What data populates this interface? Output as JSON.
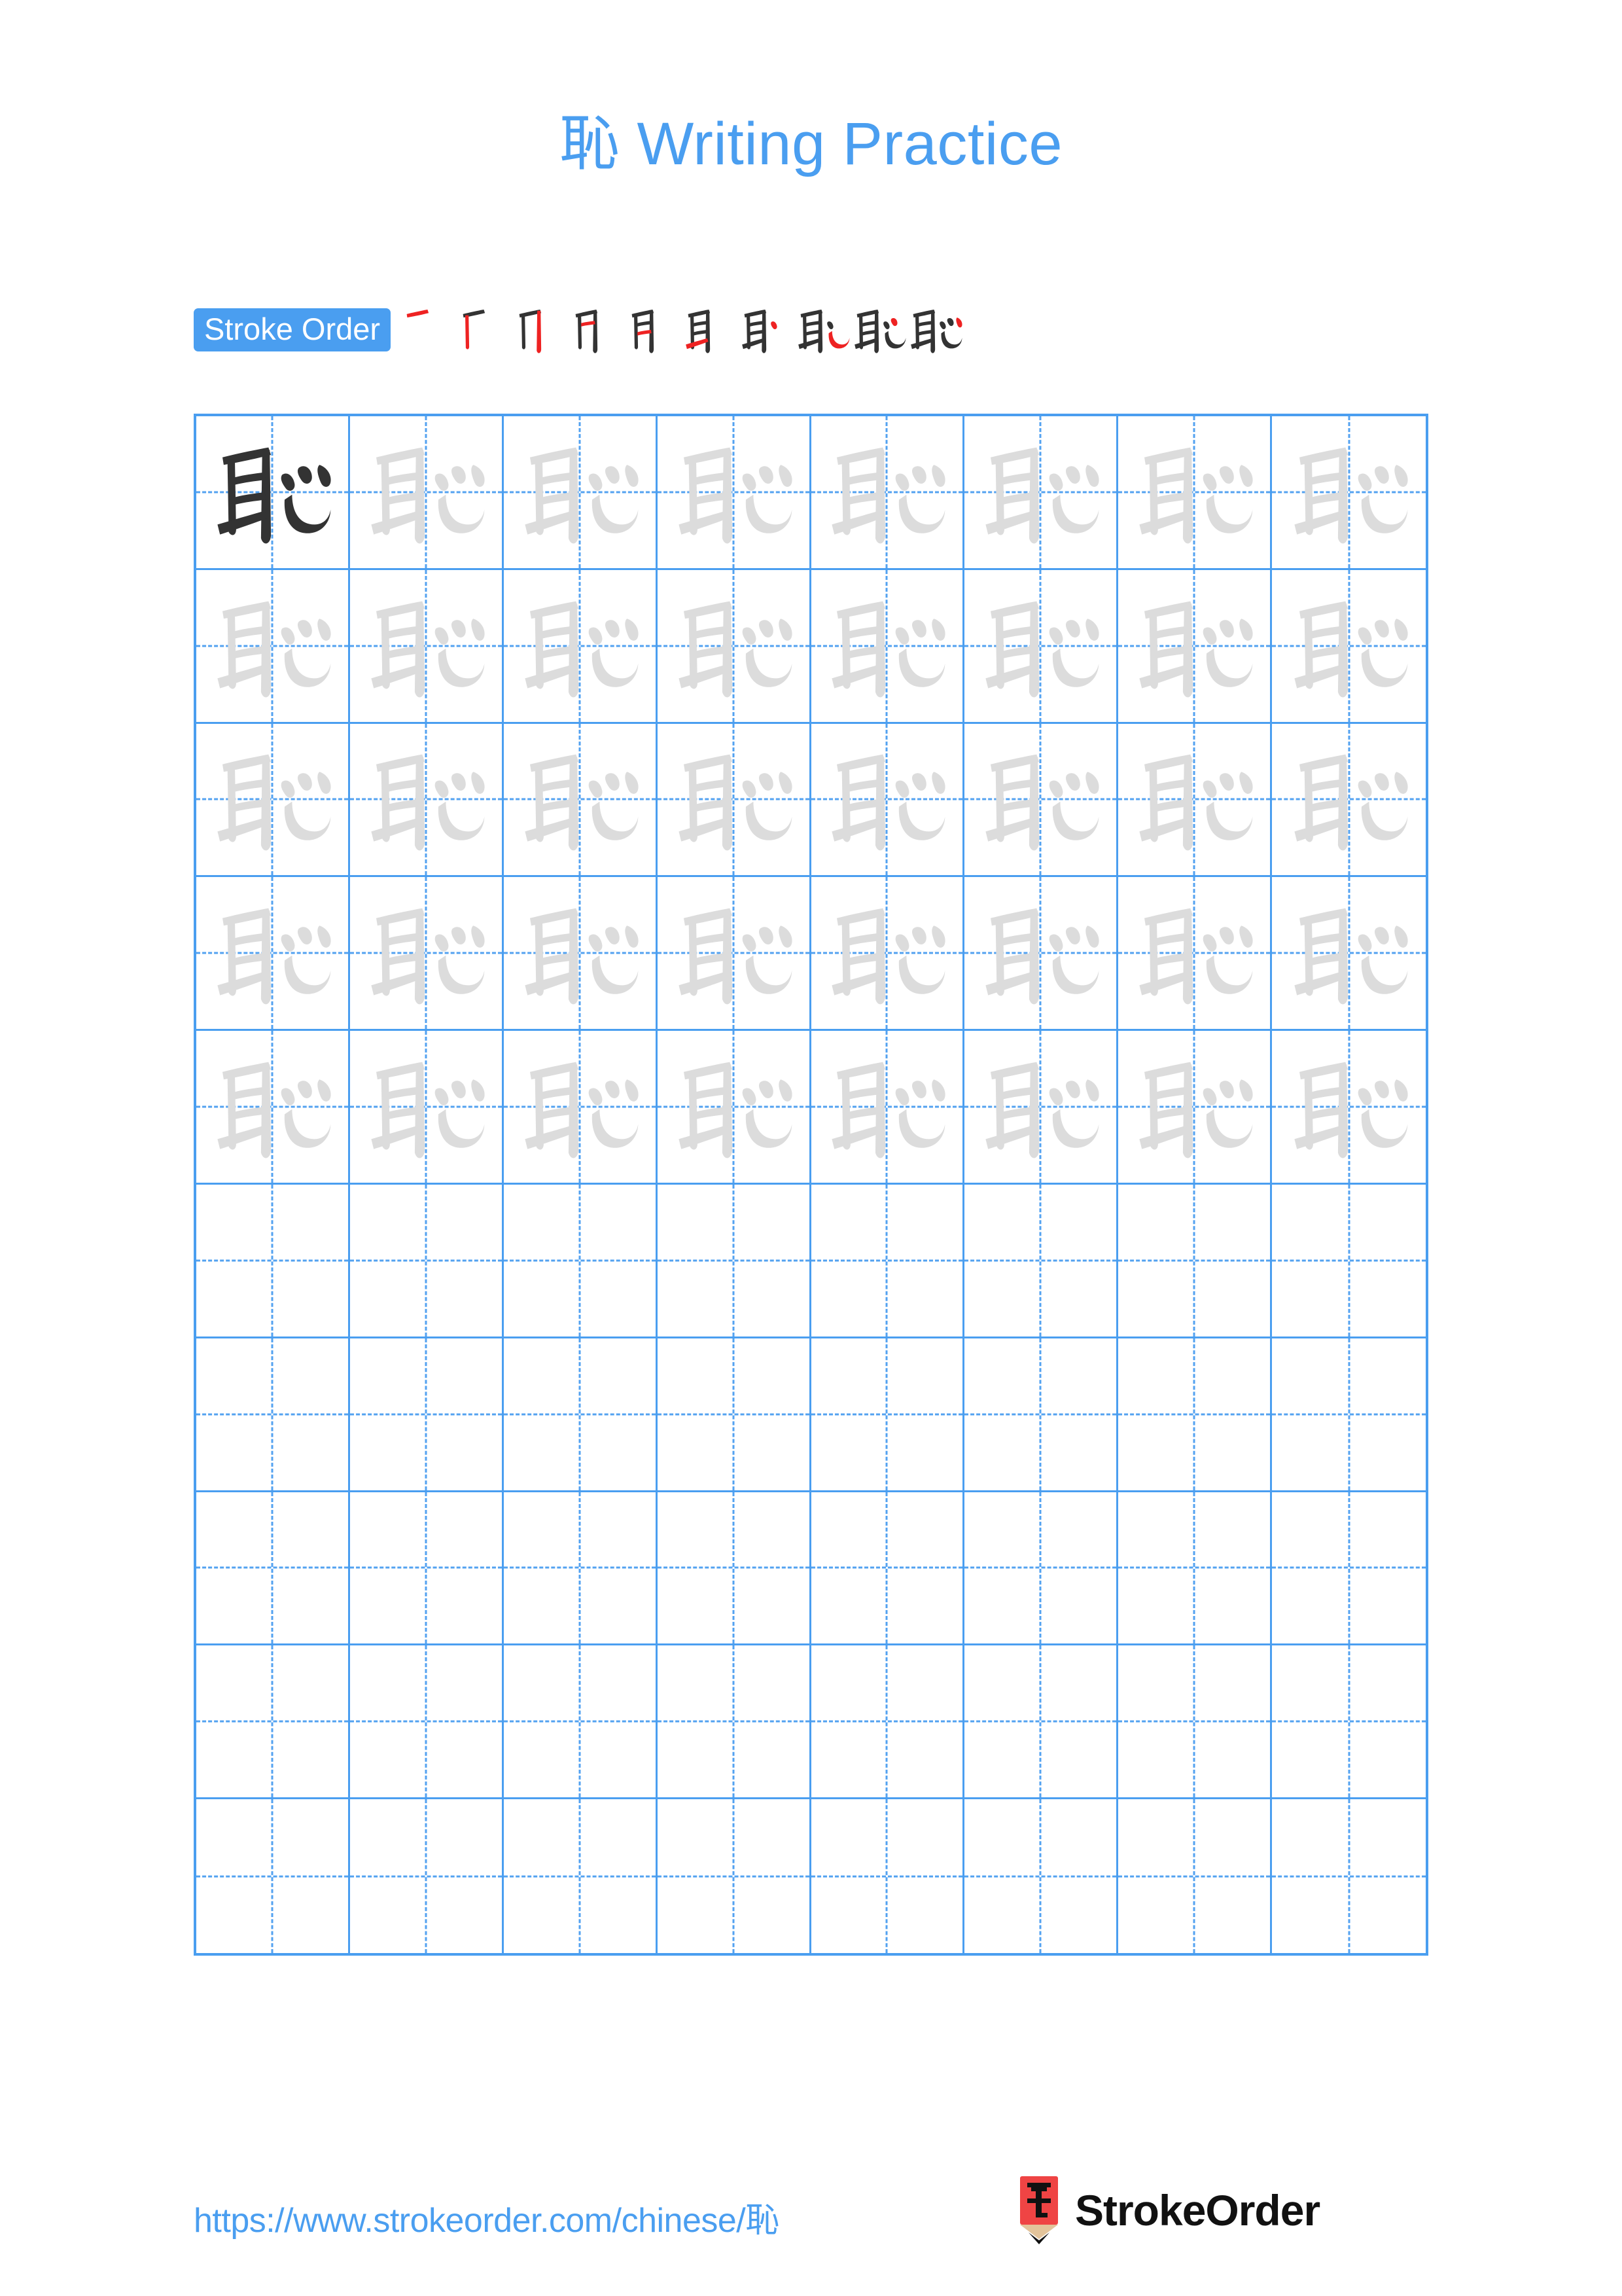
{
  "page": {
    "character": "恥",
    "title": "恥 Writing Practice",
    "accent_color": "#4a9ef0",
    "trace_color": "#dcdcdc",
    "ink_color": "#333333",
    "new_stroke_color": "#ee2222"
  },
  "stroke_order": {
    "label": "Stroke Order",
    "total_strokes": 10,
    "steps": [
      {
        "index": 1,
        "new_stroke": "横 (héng)"
      },
      {
        "index": 2,
        "new_stroke": "竖 (shù)"
      },
      {
        "index": 3,
        "new_stroke": "竖 (shù)"
      },
      {
        "index": 4,
        "new_stroke": "横 (héng)"
      },
      {
        "index": 5,
        "new_stroke": "横 (héng)"
      },
      {
        "index": 6,
        "new_stroke": "提 (tí)"
      },
      {
        "index": 7,
        "new_stroke": "点 (diǎn)"
      },
      {
        "index": 8,
        "new_stroke": "卧钩 (wògōu)"
      },
      {
        "index": 9,
        "new_stroke": "点 (diǎn)"
      },
      {
        "index": 10,
        "new_stroke": "点 (diǎn)"
      }
    ]
  },
  "practice_grid": {
    "columns": 8,
    "rows": 10,
    "filled_rows": 5,
    "blank_rows": 5,
    "first_cell_style": "dark",
    "trace_cell_style": "light",
    "guide_line_style": "dashed-cross"
  },
  "footer": {
    "url": "https://www.strokeorder.com/chinese/恥",
    "brand": "StrokeOrder",
    "logo_char": "字",
    "logo_body_color": "#ef4444",
    "logo_wood_color": "#e3c49b",
    "logo_tip_color": "#111111"
  }
}
